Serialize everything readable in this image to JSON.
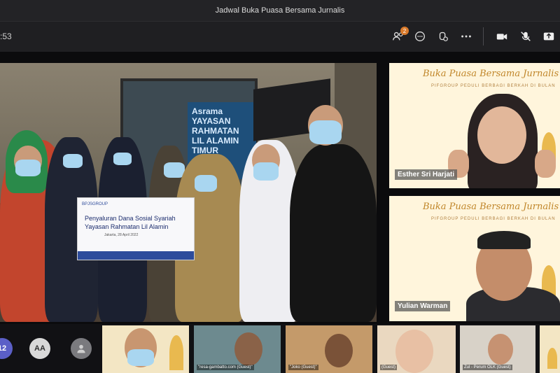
{
  "window": {
    "title": "Jadwal Buka Puasa Bersama Jurnalis"
  },
  "toolbar": {
    "timer": ":53",
    "participants_badge": "2",
    "icons": [
      "people-icon",
      "chat-icon",
      "raise-hand-icon",
      "more-icon",
      "camera-icon",
      "mic-off-icon",
      "share-icon"
    ]
  },
  "main_video": {
    "sign_text": "Asrama YAYASAN RAHMATAN LIL ALAMIN TIMUR",
    "banner": {
      "logo_text": "BPJSGROUP",
      "line1": "Penyaluran Dana Sosial Syariah",
      "line2": "Yayasan Rahmatan Lil Alamin",
      "line3": "Jakarta, 28 April 2022"
    }
  },
  "side_tiles": [
    {
      "header": "Buka Puasa Bersama Jurnalis",
      "sub": "PIFGROUP PEDULI BERBAGI BERKAH DI BULAN",
      "name": "Esther Sri Harjati"
    },
    {
      "header": "Buka Puasa Bersama Jurnalis",
      "sub": "PIFGROUP PEDULI BERBAGI BERKAH DI BULAN",
      "name": "Yulian Warman"
    }
  ],
  "bottom_strip": {
    "count_badge": "12",
    "avatar_initials": "AA",
    "thumbnails": [
      {
        "caption": ""
      },
      {
        "caption": "\"resa-gambatto.com (Guest)\""
      },
      {
        "caption": "\"Joko (Guest)\""
      },
      {
        "caption": "(Guest)"
      },
      {
        "caption": "Zul - Perum OLK (Guest)"
      }
    ]
  },
  "colors": {
    "accent_badge": "#d97a2b",
    "tile_bg": "#fff5dc",
    "header_gold": "#c0862a"
  }
}
